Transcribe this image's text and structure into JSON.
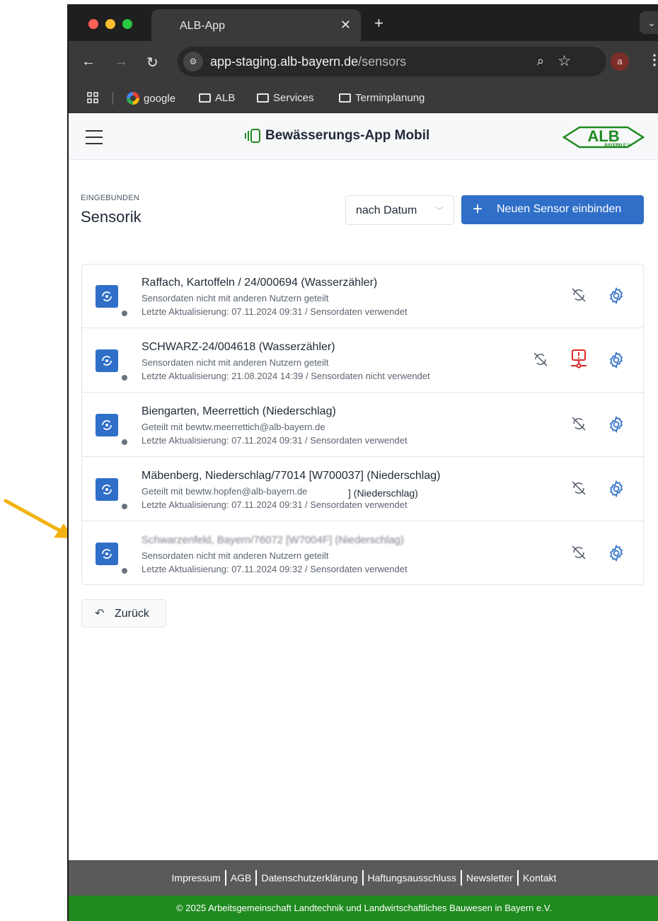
{
  "browser": {
    "tab_title": "ALB-App",
    "url_host": "app-staging.alb-bayern.de",
    "url_path": "/sensors",
    "profile_initial": "a",
    "bookmarks": [
      "google",
      "ALB",
      "Services",
      "Terminplanung"
    ]
  },
  "header": {
    "title": "Bewässerungs-App Mobil",
    "logo_text": "ALB",
    "logo_subtext": "BAYERN E.V."
  },
  "page": {
    "kicker": "EINGEBUNDEN",
    "title": "Sensorik",
    "sort_value": "nach Datum",
    "add_button": "Neuen Sensor einbinden",
    "back_button": "Zurück"
  },
  "sensors": [
    {
      "title": "Raffach, Kartoffeln / 24/000694 (Wasserzähler)",
      "share": "Sensordaten nicht mit anderen Nutzern geteilt",
      "update": "Letzte Aktualisierung: 07.11.2024 09:31 / Sensordaten verwendet",
      "alert": false
    },
    {
      "title": "SCHWARZ-24/004618 (Wasserzähler)",
      "share": "Sensordaten nicht mit anderen Nutzern geteilt",
      "update": "Letzte Aktualisierung: 21.08.2024 14:39 / Sensordaten nicht verwendet",
      "alert": true
    },
    {
      "title": "Biengarten, Meerrettich (Niederschlag)",
      "share": "Geteilt mit bewtw.meerrettich@alb-bayern.de",
      "update": "Letzte Aktualisierung: 07.11.2024 09:31 / Sensordaten verwendet",
      "alert": false
    },
    {
      "title": "Mäbenberg, Niederschlag/77014 [W700037] (Niederschlag)",
      "share": "Geteilt mit bewtw.hopfen@alb-bayern.de",
      "extra": "] (Niederschlag)",
      "update": "Letzte Aktualisierung: 07.11.2024 09:31 / Sensordaten verwendet",
      "alert": false
    },
    {
      "title": "Schwarzenfeld, Bayern/76072 [W7004F] (Niederschlag)",
      "share": "Sensordaten nicht mit anderen Nutzern geteilt",
      "update": "Letzte Aktualisierung: 07.11.2024 09:32 / Sensordaten verwendet",
      "alert": false
    }
  ],
  "footer": {
    "links": [
      "Impressum",
      "AGB",
      "Datenschutzerklärung",
      "Haftungsausschluss",
      "Newsletter",
      "Kontakt"
    ],
    "copyright": "© 2025 Arbeitsgemeinschaft Landtechnik und Landwirtschaftliches Bauwesen in Bayern e.V."
  },
  "colors": {
    "primary": "#2f6fc8",
    "alert": "#dc2626",
    "footer_green": "#1f8a1f",
    "annotation_arrow": "#f2b311"
  }
}
